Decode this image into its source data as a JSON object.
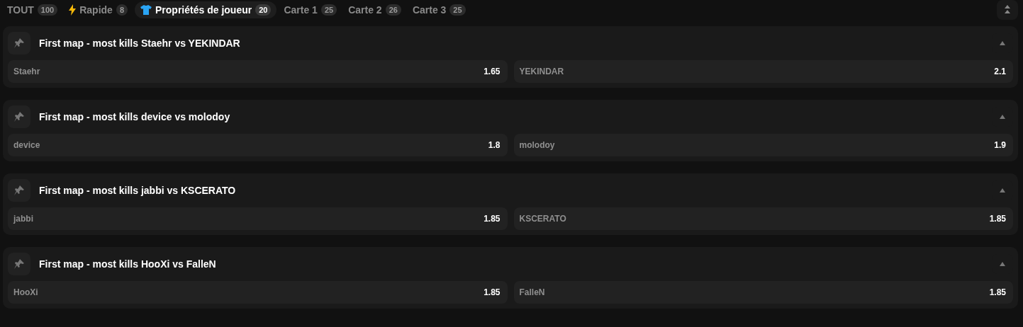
{
  "tabs": [
    {
      "label": "TOUT",
      "count": "100",
      "kind": "plain",
      "selected": false
    },
    {
      "label": "Rapide",
      "count": "8",
      "kind": "quick",
      "selected": false
    },
    {
      "label": "Propriétés de joueur",
      "count": "20",
      "kind": "player",
      "selected": true
    },
    {
      "label": "Carte 1",
      "count": "25",
      "kind": "plain",
      "selected": false
    },
    {
      "label": "Carte 2",
      "count": "26",
      "kind": "plain",
      "selected": false
    },
    {
      "label": "Carte 3",
      "count": "25",
      "kind": "plain",
      "selected": false
    }
  ],
  "markets": [
    {
      "title": "First map - most kills Staehr vs YEKINDAR",
      "expanded": true,
      "outcomes": [
        {
          "name": "Staehr",
          "odds": "1.65"
        },
        {
          "name": "YEKINDAR",
          "odds": "2.1"
        }
      ]
    },
    {
      "title": "First map - most kills device vs molodoy",
      "expanded": true,
      "outcomes": [
        {
          "name": "device",
          "odds": "1.8"
        },
        {
          "name": "molodoy",
          "odds": "1.9"
        }
      ]
    },
    {
      "title": "First map - most kills jabbi vs KSCERATO",
      "expanded": true,
      "outcomes": [
        {
          "name": "jabbi",
          "odds": "1.85"
        },
        {
          "name": "KSCERATO",
          "odds": "1.85"
        }
      ]
    },
    {
      "title": "First map - most kills HooXi vs FalleN",
      "expanded": true,
      "outcomes": [
        {
          "name": "HooXi",
          "odds": "1.85"
        },
        {
          "name": "FalleN",
          "odds": "1.85"
        }
      ]
    }
  ]
}
